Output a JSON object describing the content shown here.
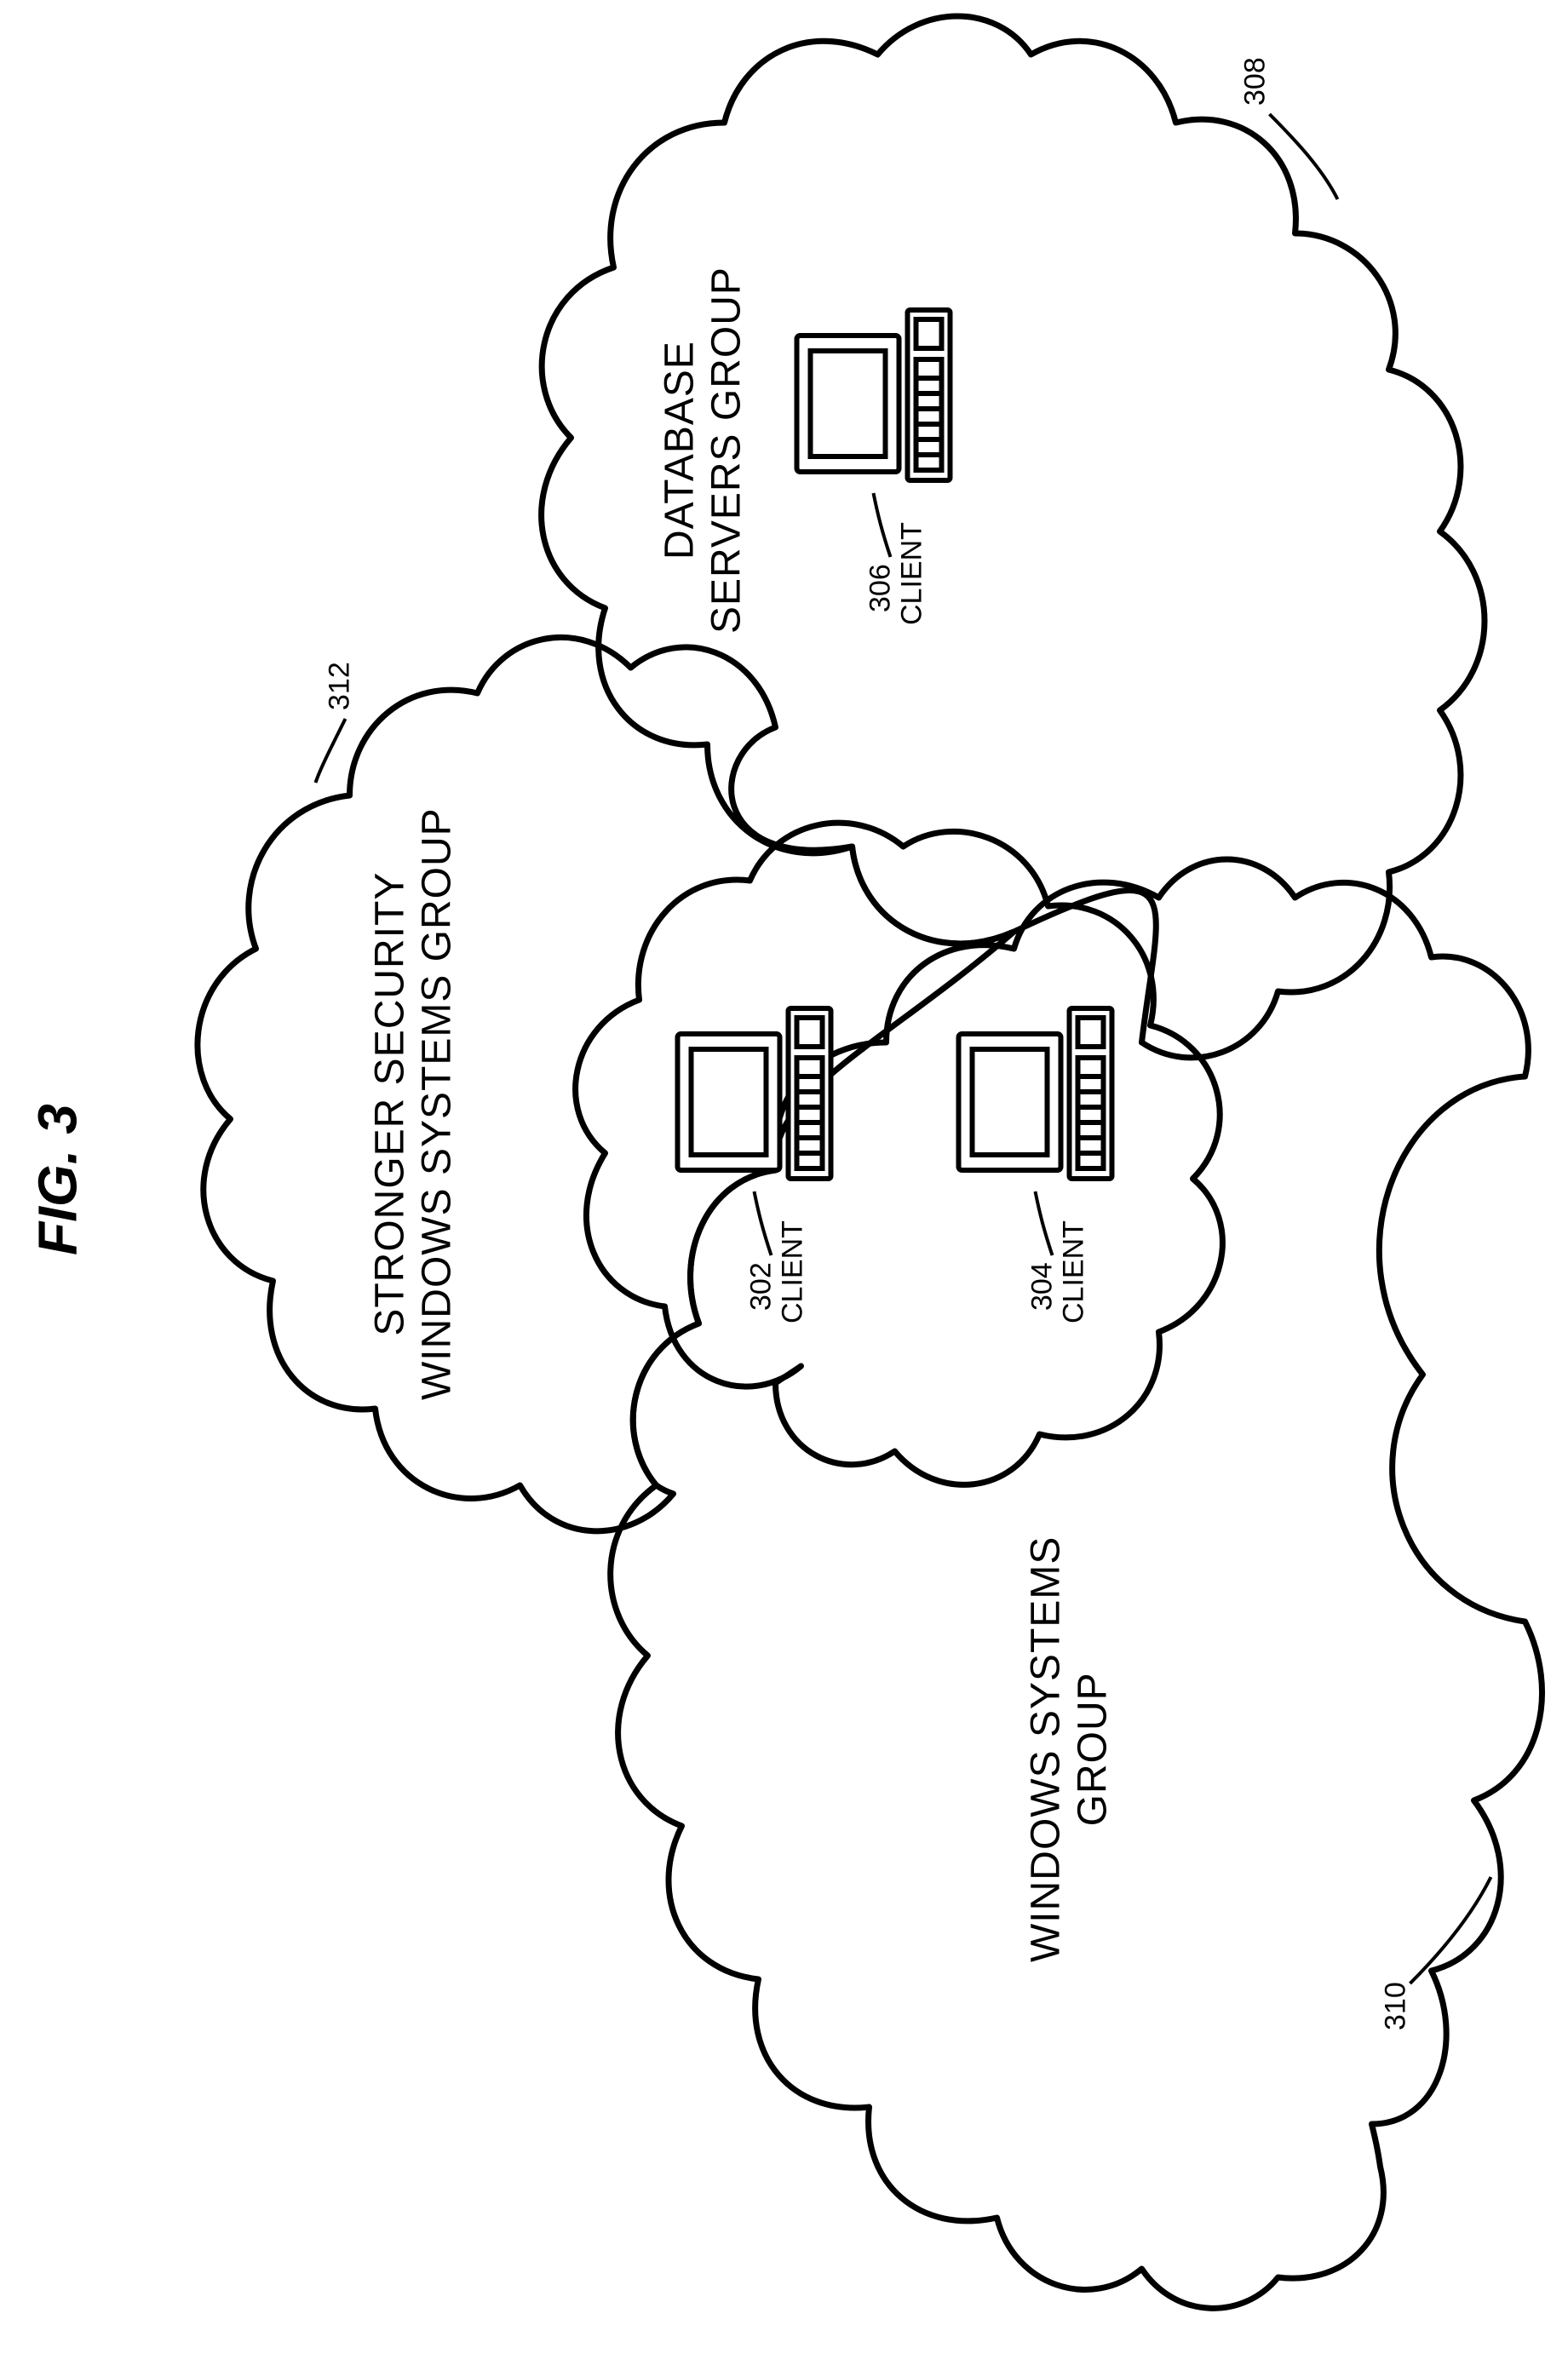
{
  "figure_title": "FIG. 3",
  "groups": {
    "windows_systems": {
      "label_line1": "WINDOWS SYSTEMS",
      "label_line2": "GROUP",
      "ref": "310"
    },
    "database_servers": {
      "label_line1": "DATABASE",
      "label_line2": "SERVERS GROUP",
      "ref": "308"
    },
    "stronger_security": {
      "label_line1": "STRONGER SECURITY",
      "label_line2": "WINDOWS SYSTEMS GROUP",
      "ref": "312"
    }
  },
  "clients": {
    "c302": {
      "ref": "302",
      "label": "CLIENT"
    },
    "c304": {
      "ref": "304",
      "label": "CLIENT"
    },
    "c306": {
      "ref": "306",
      "label": "CLIENT"
    }
  }
}
